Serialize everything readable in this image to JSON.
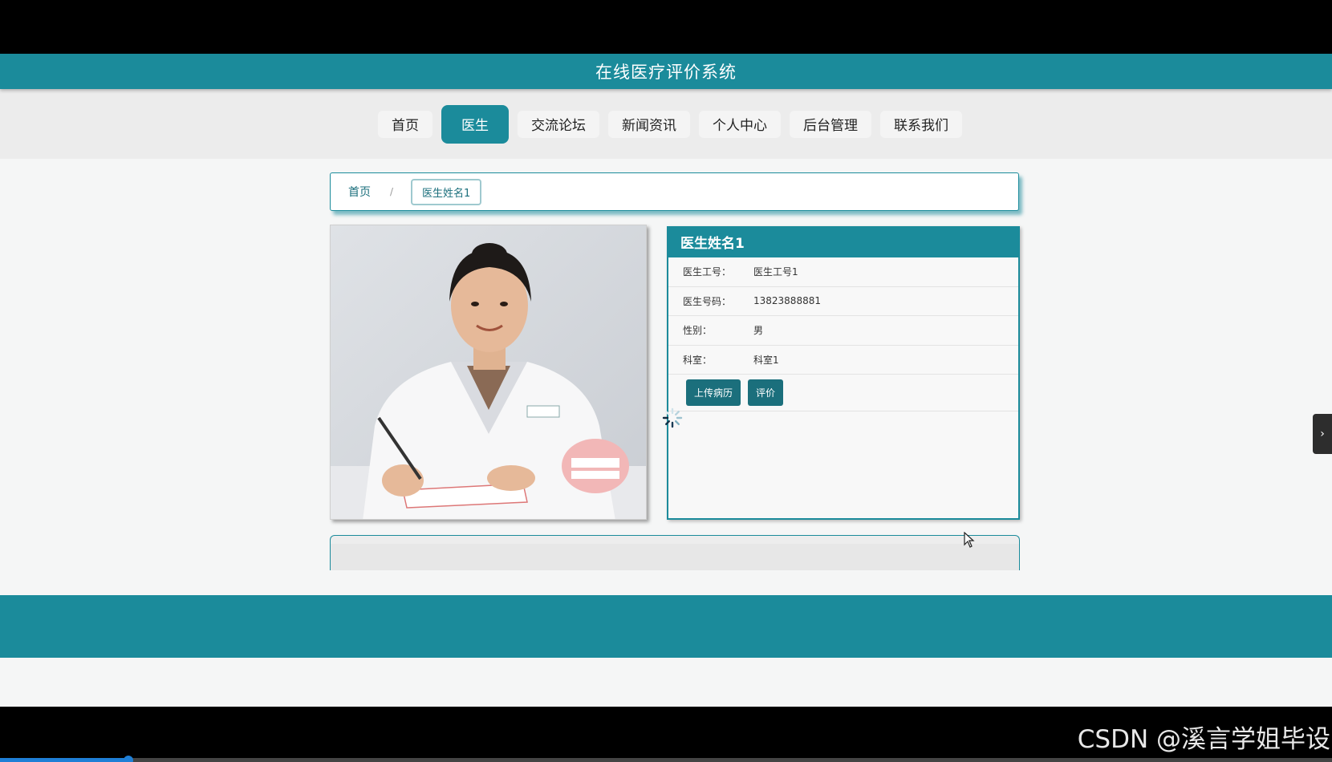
{
  "app": {
    "title": "在线医疗评价系统"
  },
  "nav": {
    "items": [
      {
        "label": "首页"
      },
      {
        "label": "医生"
      },
      {
        "label": "交流论坛"
      },
      {
        "label": "新闻资讯"
      },
      {
        "label": "个人中心"
      },
      {
        "label": "后台管理"
      },
      {
        "label": "联系我们"
      }
    ],
    "active_index": 1
  },
  "breadcrumb": {
    "home": "首页",
    "separator": "/",
    "current": "医生姓名1"
  },
  "doctor": {
    "name": "医生姓名1",
    "fields": [
      {
        "label": "医生工号：",
        "value": "医生工号1"
      },
      {
        "label": "医生号码：",
        "value": "13823888881"
      },
      {
        "label": "性别：",
        "value": "男"
      },
      {
        "label": "科室：",
        "value": "科室1"
      }
    ],
    "actions": {
      "upload": "上传病历",
      "rate": "评价"
    }
  },
  "colors": {
    "brand": "#1b8b9b",
    "button": "#1b6f7c",
    "page_bg": "#f5f6f6"
  },
  "watermark": "CSDN @溪言学姐毕设",
  "icons": {
    "side_tab": "chevron-right-icon",
    "loading": "spinner-icon",
    "pointer": "cursor-icon"
  }
}
